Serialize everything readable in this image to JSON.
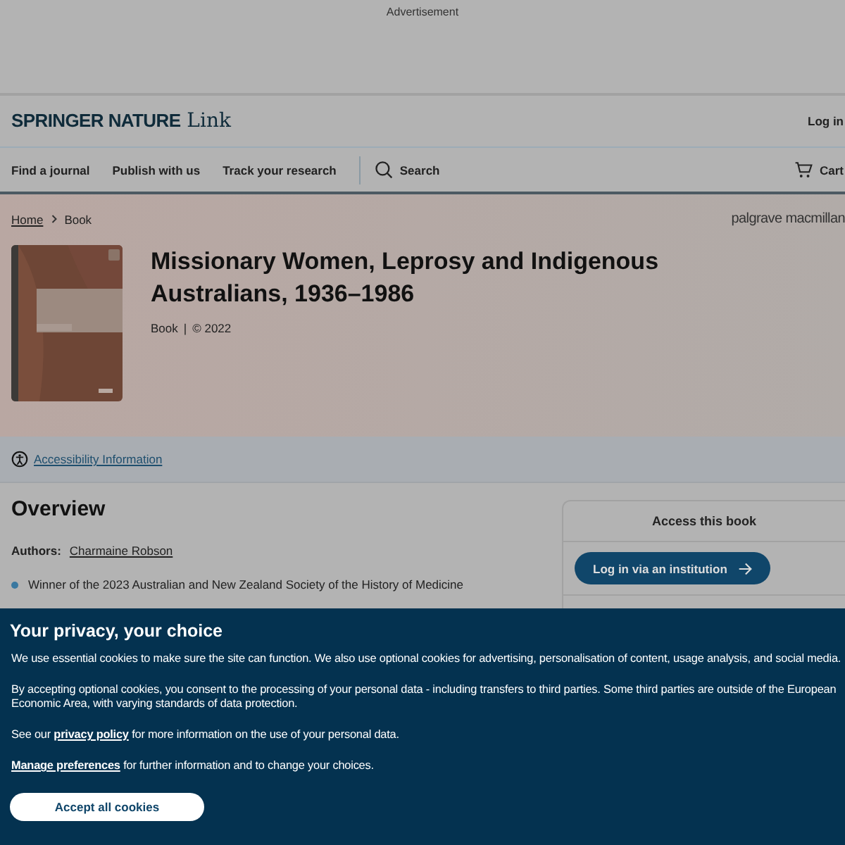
{
  "advertisement": {
    "label": "Advertisement"
  },
  "header": {
    "logo_bold": "SPRINGER NATURE",
    "logo_light": "Link",
    "login": "Log in"
  },
  "nav": {
    "items": [
      "Find a journal",
      "Publish with us",
      "Track your research"
    ],
    "search": "Search",
    "cart": "Cart"
  },
  "breadcrumb": [
    {
      "label": "Home",
      "link": true
    },
    {
      "label": "Book",
      "link": false
    }
  ],
  "publisher": "palgrave macmillan",
  "book": {
    "title": "Missionary Women, Leprosy and Indigenous Australians, 1936–1986",
    "type": "Book",
    "separator": "|",
    "year": "© 2022"
  },
  "accessibility_link": "Accessibility Information",
  "overview": {
    "heading": "Overview",
    "authors_label": "Authors:",
    "author": "Charmaine Robson",
    "bullets": [
      "Winner of the 2023 Australian and New Zealand Society of the History of Medicine"
    ]
  },
  "access_panel": {
    "heading": "Access this book",
    "button": "Log in via an institution"
  },
  "cookie_banner": {
    "title": "Your privacy, your choice",
    "paragraphs": [
      "We use essential cookies to make sure the site can function. We also use optional cookies for advertising, personalisation of content, usage analysis, and social media.",
      "By accepting optional cookies, you consent to the processing of your personal data - including transfers to third parties. Some third parties are outside of the European Economic Area, with varying standards of data protection."
    ],
    "policy_before": "See our",
    "policy_link": "privacy policy",
    "policy_after": "for more information on the use of your personal data.",
    "manage_link": "Manage preferences",
    "manage_after": "for further information and to change your choices.",
    "accept_button": "Accept all cookies"
  }
}
